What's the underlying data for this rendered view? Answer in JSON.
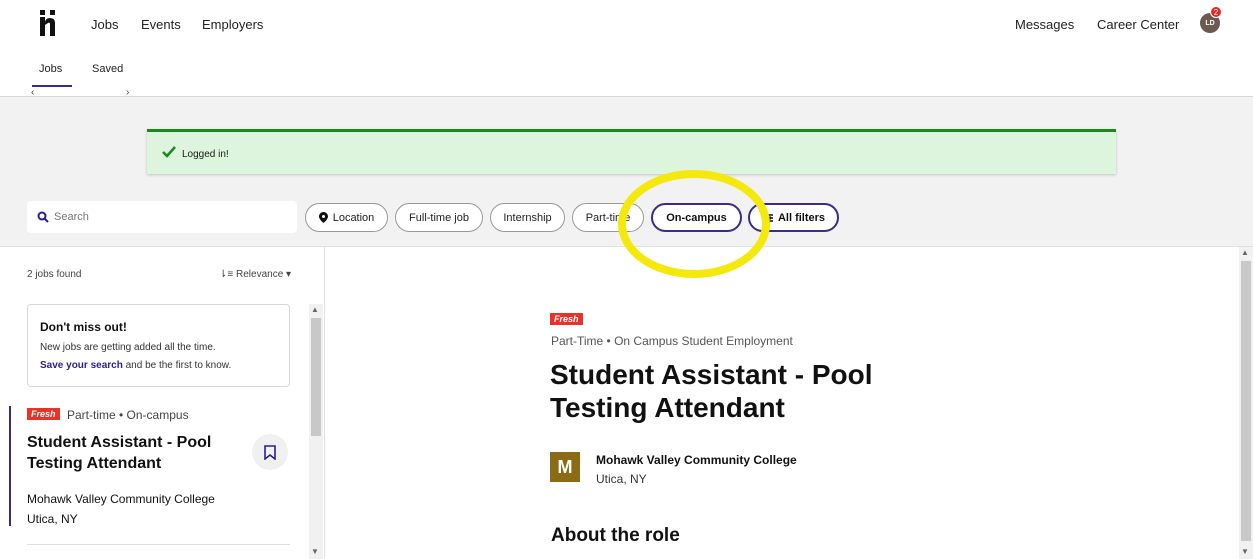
{
  "nav": {
    "links": [
      "Jobs",
      "Events",
      "Employers"
    ],
    "messages": "Messages",
    "career_center": "Career Center",
    "avatar_initials": "LD",
    "notification_count": "2"
  },
  "subtabs": {
    "jobs": "Jobs",
    "saved": "Saved"
  },
  "alert": {
    "text": "Logged in!"
  },
  "search": {
    "placeholder": "Search"
  },
  "filters": {
    "location": "Location",
    "full_time": "Full-time job",
    "internship": "Internship",
    "part_time": "Part-time",
    "on_campus": "On-campus",
    "all_filters": "All filters"
  },
  "list": {
    "count": "2 jobs found",
    "sort": "Relevance",
    "promo": {
      "title": "Don't miss out!",
      "line1": "New jobs are getting added all the time.",
      "link": "Save your search",
      "line2_rest": " and be the first to know."
    },
    "card": {
      "badge": "Fresh",
      "meta": "Part-time • On-campus",
      "title": "Student Assistant - Pool Testing Attendant",
      "employer": "Mohawk Valley Community College",
      "location": "Utica, NY"
    }
  },
  "detail": {
    "badge": "Fresh",
    "meta": "Part-Time • On Campus Student Employment",
    "title": "Student Assistant - Pool Testing Attendant",
    "employer_initial": "M",
    "employer": "Mohawk Valley Community College",
    "location": "Utica, NY",
    "section": "About the role"
  },
  "colors": {
    "accent": "#3a2b8c",
    "fresh": "#e8332a",
    "success": "#1b8a1b",
    "highlight": "#f5e80c",
    "employer_logo": "#8b6b14"
  }
}
